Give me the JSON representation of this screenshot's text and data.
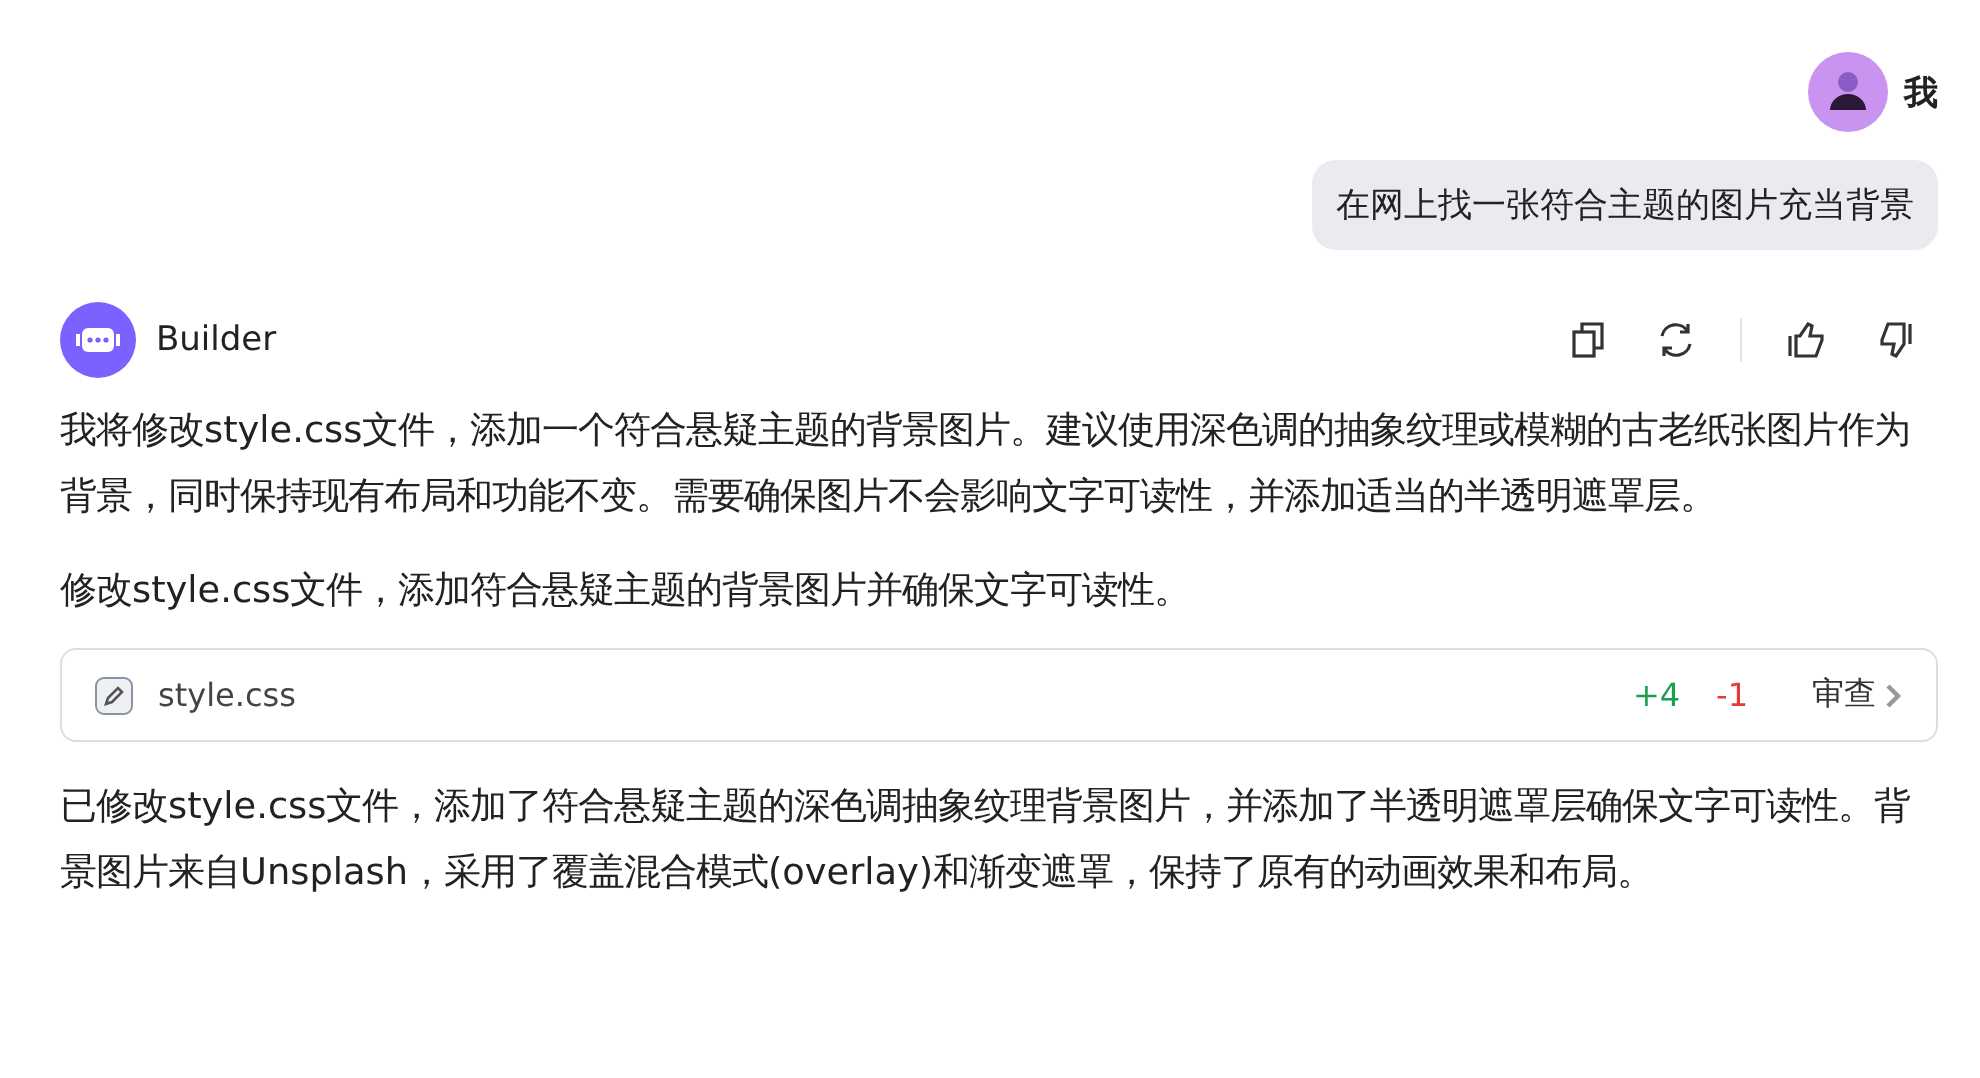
{
  "user": {
    "name": "我",
    "message": "在网上找一张符合主题的图片充当背景"
  },
  "assistant": {
    "name": "Builder",
    "paragraphs": [
      "我将修改style.css文件，添加一个符合悬疑主题的背景图片。建议使用深色调的抽象纹理或模糊的古老纸张图片作为背景，同时保持现有布局和功能不变。需要确保图片不会影响文字可读性，并添加适当的半透明遮罩层。",
      "修改style.css文件，添加符合悬疑主题的背景图片并确保文字可读性。"
    ],
    "file_change": {
      "filename": "style.css",
      "additions": "+4",
      "deletions": "-1",
      "review": "审查"
    },
    "summary": "已修改style.css文件，添加了符合悬疑主题的深色调抽象纹理背景图片，并添加了半透明遮罩层确保文字可读性。背景图片来自Unsplash，采用了覆盖混合模式(overlay)和渐变遮罩，保持了原有的动画效果和布局。"
  }
}
